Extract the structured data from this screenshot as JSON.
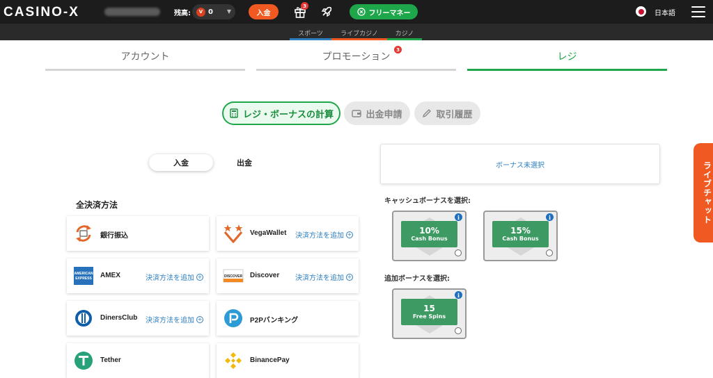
{
  "header": {
    "logo": "CASINO-X",
    "balance_label": "残高:",
    "balance_value": "0",
    "balance_coin": "V",
    "deposit_label": "入金",
    "gift_badge": "3",
    "free_money_label": "フリーマネー",
    "language": "日本語"
  },
  "subnav": {
    "items": [
      {
        "label": "スポーツ",
        "color": "#2d7fc1"
      },
      {
        "label": "ライブカジノ",
        "color": "#f05a22"
      },
      {
        "label": "カジノ",
        "color": "#1ea64a"
      }
    ]
  },
  "main_tabs": {
    "items": [
      {
        "label": "アカウント"
      },
      {
        "label": "プロモーション",
        "badge": "3"
      },
      {
        "label": "レジ",
        "active": true
      }
    ]
  },
  "cashier_tabs": {
    "items": [
      {
        "label": "レジ・ボーナスの計算",
        "icon": "calculator-icon",
        "active": true
      },
      {
        "label": "出金申請",
        "icon": "wallet-icon"
      },
      {
        "label": "取引履歴",
        "icon": "pencil-icon"
      }
    ]
  },
  "toggle": {
    "deposit": "入金",
    "withdraw": "出金"
  },
  "methods": {
    "title": "全決済方法",
    "add_label": "決済方法を追加",
    "items": [
      {
        "name": "銀行振込",
        "icon": "bank-transfer-icon",
        "add": false
      },
      {
        "name": "VegaWallet",
        "icon": "vegawallet-icon",
        "add": true
      },
      {
        "name": "AMEX",
        "icon": "amex-icon",
        "add": true,
        "logo_text": "AMERICAN EXPRESS"
      },
      {
        "name": "Discover",
        "icon": "discover-icon",
        "add": true,
        "logo_text": "DISCOVER"
      },
      {
        "name": "DinersClub",
        "icon": "dinersclub-icon",
        "add": true
      },
      {
        "name": "P2Pバンキング",
        "icon": "p2p-icon",
        "add": false
      },
      {
        "name": "Tether",
        "icon": "tether-icon",
        "add": false
      },
      {
        "name": "BinancePay",
        "icon": "binance-icon",
        "add": false
      }
    ]
  },
  "bonus": {
    "none_selected": "ボーナス未選択",
    "cash_title": "キャッシュボーナスを選択:",
    "extra_title": "追加ボーナスを選択:",
    "cash_bonuses": [
      {
        "value": "10%",
        "label": "Cash Bonus"
      },
      {
        "value": "15%",
        "label": "Cash Bonus"
      }
    ],
    "extra_bonuses": [
      {
        "value": "15",
        "label": "Free Spins"
      }
    ],
    "info_glyph": "i",
    "ribbon_color": "#3d9a63"
  },
  "livechat": {
    "label": "ライブチャット"
  }
}
